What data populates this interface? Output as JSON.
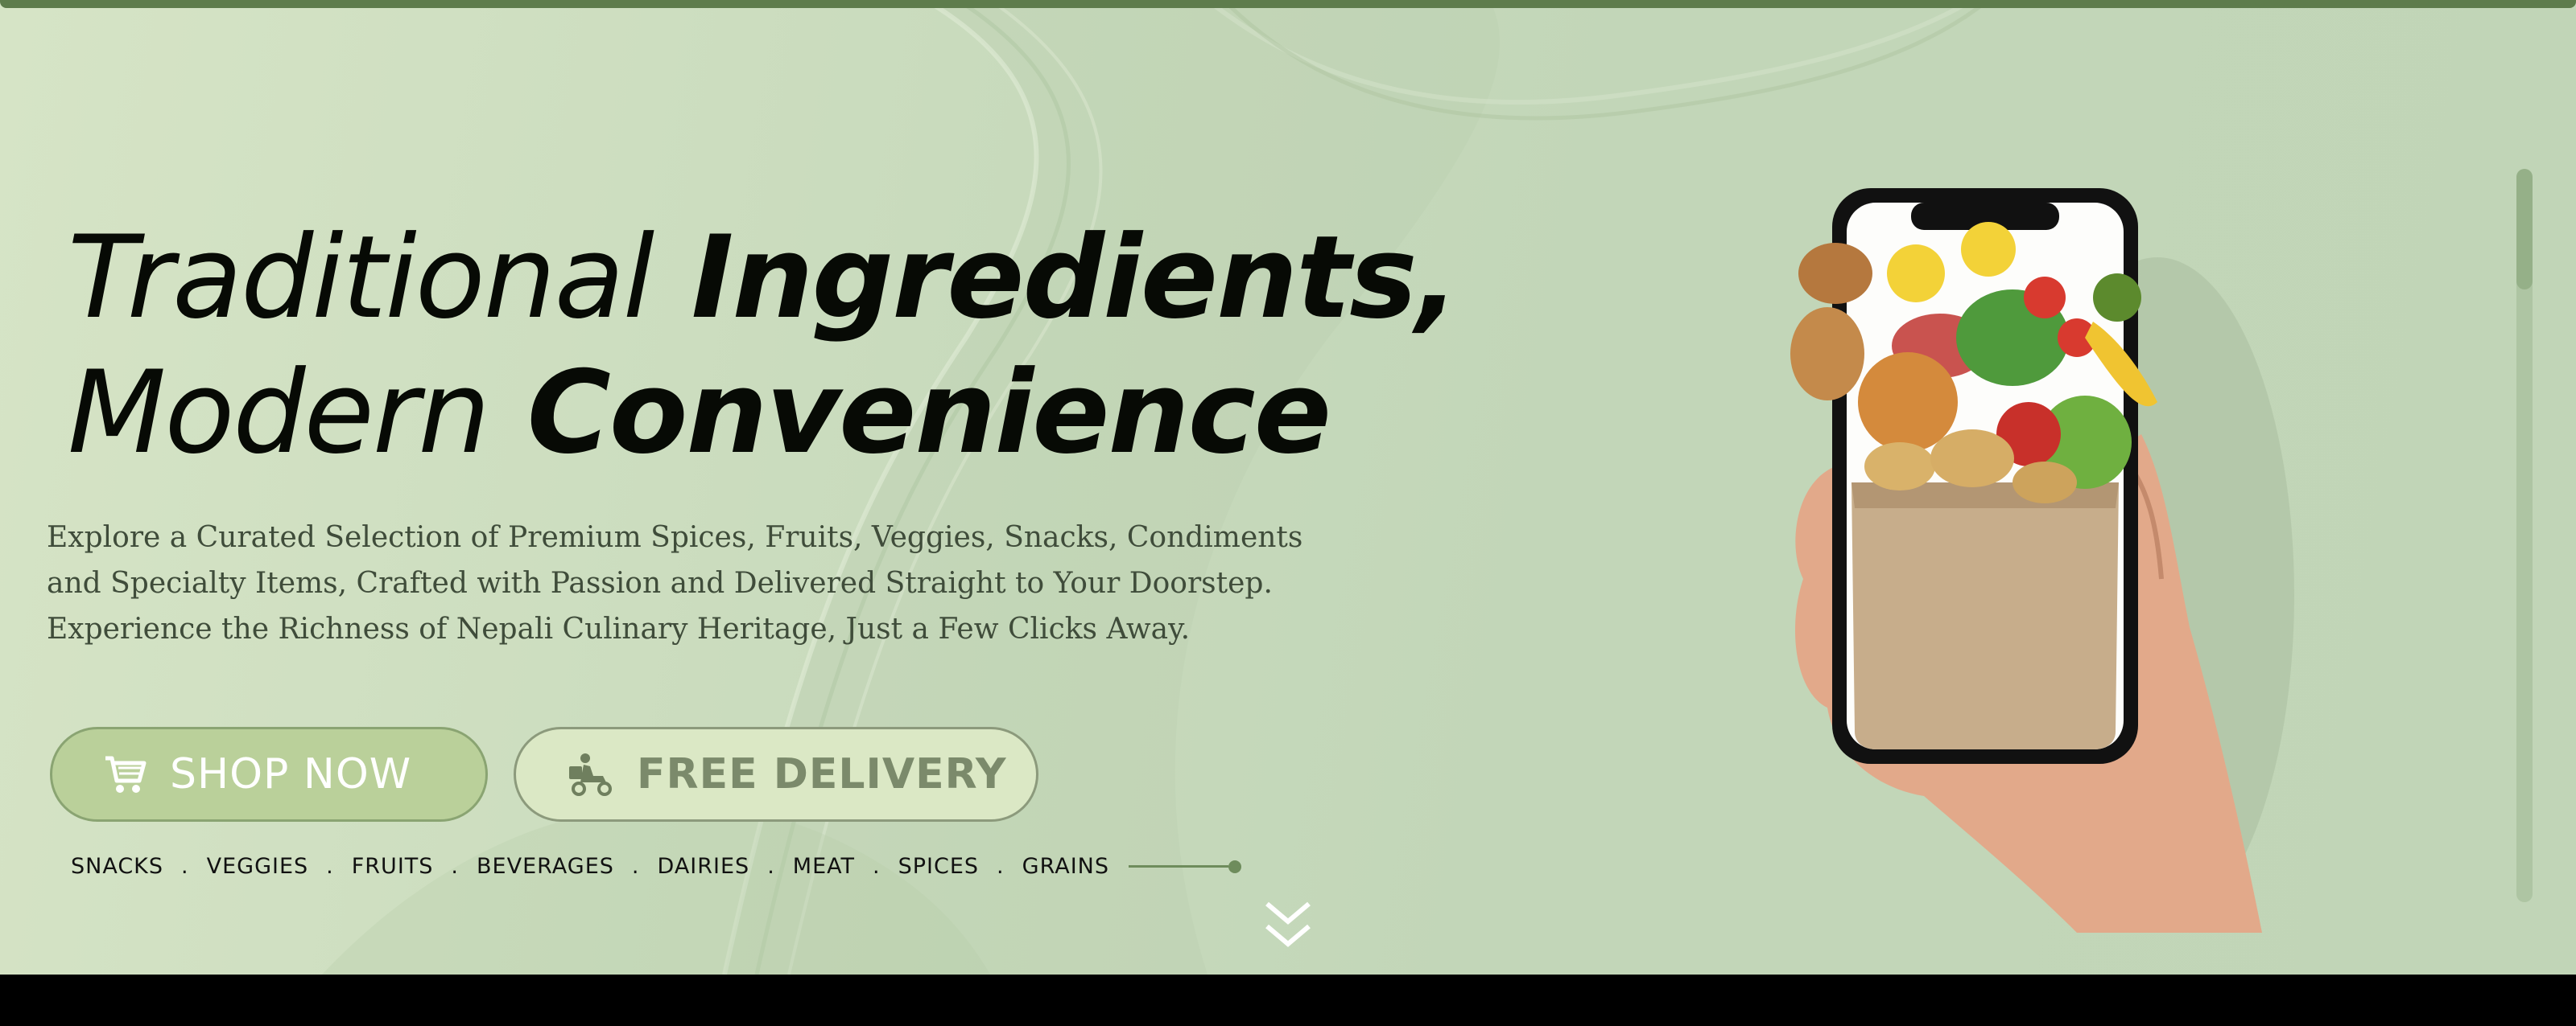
{
  "hero": {
    "headline_line1_light": "Traditional",
    "headline_line1_bold": "Ingredients,",
    "headline_line2_light": "Modern",
    "headline_line2_bold": "Convenience",
    "description": "Explore a Curated Selection of Premium Spices, Fruits, Veggies, Snacks, Condiments and Specialty Items, Crafted with Passion and Delivered Straight to Your Doorstep. Experience the Richness of Nepali Culinary Heritage, Just a Few Clicks Away."
  },
  "buttons": {
    "shop_now": "SHOP NOW",
    "shop_now_icon": "cart-icon",
    "free_delivery": "FREE DELIVERY",
    "free_delivery_icon": "delivery-scooter-icon"
  },
  "categories": [
    "SNACKS",
    "VEGGIES",
    "FRUITS",
    "BEVERAGES",
    "DAIRIES",
    "MEAT",
    "SPICES",
    "GRAINS"
  ],
  "category_separator": ".",
  "colors": {
    "background": "#c9dbbd",
    "top_bar": "#5e7c4c",
    "shop_button": "#bad09a",
    "delivery_button": "#dbe8c5",
    "headline": "#070a05",
    "accent_line": "#6e8c5c"
  }
}
